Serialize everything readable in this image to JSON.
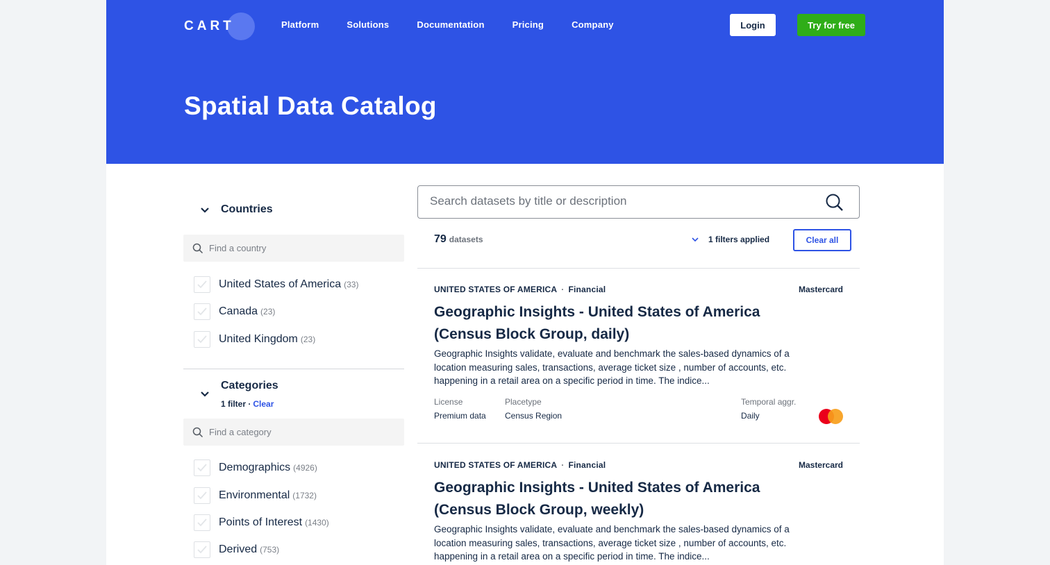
{
  "brand": {
    "logo_text": "CART",
    "logo_suffix": "O"
  },
  "nav": [
    "Platform",
    "Solutions",
    "Documentation",
    "Pricing",
    "Company"
  ],
  "header": {
    "login": "Login",
    "try": "Try for free",
    "title": "Spatial Data Catalog"
  },
  "sidebar": {
    "countries": {
      "title": "Countries",
      "search_placeholder": "Find a country",
      "items": [
        {
          "label": "United States of America",
          "count": "(33)"
        },
        {
          "label": "Canada",
          "count": "(23)"
        },
        {
          "label": "United Kingdom",
          "count": "(23)"
        }
      ]
    },
    "categories": {
      "title": "Categories",
      "filter_text": "1 filter ·",
      "clear": "Clear",
      "search_placeholder": "Find a category",
      "items": [
        {
          "label": "Demographics",
          "count": "(4926)"
        },
        {
          "label": "Environmental",
          "count": "(1732)"
        },
        {
          "label": "Points of Interest",
          "count": "(1430)"
        },
        {
          "label": "Derived",
          "count": "(753)"
        }
      ]
    }
  },
  "main": {
    "search_placeholder": "Search datasets by title or description",
    "count": "79",
    "count_label": "datasets",
    "filters_applied": "1 filters applied",
    "clear_all": "Clear all",
    "datasets": [
      {
        "country": "UNITED STATES OF AMERICA",
        "category": "Financial",
        "provider": "Mastercard",
        "title": "Geographic Insights - United States of America (Census Block Group, daily)",
        "description": "Geographic Insights validate, evaluate and benchmark the sales-based dynamics of a location measuring sales, transactions, average ticket size , number of accounts, etc. happening in a retail area on a specific period in time. The indice...",
        "license_label": "License",
        "license": "Premium data",
        "placetype_label": "Placetype",
        "placetype": "Census Region",
        "temporal_label": "Temporal aggr.",
        "temporal": "Daily"
      },
      {
        "country": "UNITED STATES OF AMERICA",
        "category": "Financial",
        "provider": "Mastercard",
        "title": "Geographic Insights - United States of America (Census Block Group, weekly)",
        "description": "Geographic Insights validate, evaluate and benchmark the sales-based dynamics of a location measuring sales, transactions, average ticket size , number of accounts, etc. happening in a retail area on a specific period in time. The indice..."
      }
    ]
  },
  "colors": {
    "brand_blue": "#2e53e5",
    "cta_green": "#2fad18"
  }
}
